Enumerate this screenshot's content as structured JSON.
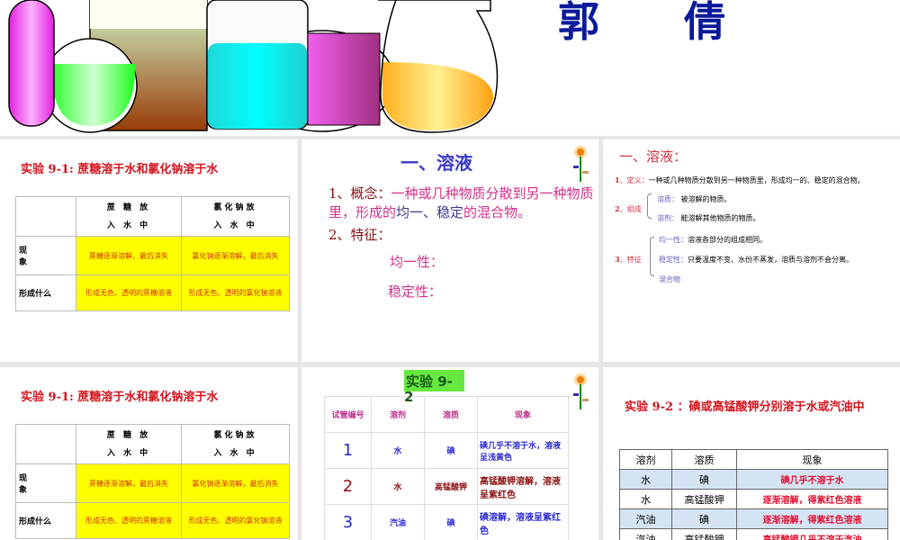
{
  "title_slide": {
    "name_1": "郭",
    "name_2": "倩"
  },
  "exp91": {
    "title": "实验 9-1: 蔗糖溶于水和氯化钠溶于水",
    "col1": [
      "蔗 糖 放",
      "入 水 中"
    ],
    "col2": [
      "氯化钠放",
      "入 水  中"
    ],
    "row1_label": [
      "现",
      "象"
    ],
    "row1": [
      "蔗糖逐渐溶解，最后消失",
      "氯化钠逐渐溶解，最后消失"
    ],
    "row2_label": "形成什么",
    "row2": [
      "形成无色、透明的蔗糖溶液",
      "形成无色、透明的氯化钠溶液"
    ]
  },
  "solution": {
    "heading": "一、溶液",
    "concept_label": "1、概念：",
    "concept_a": "一种或几种物质分散到另一种物质里，形成的",
    "concept_b": "均一、稳定",
    "concept_c": "的混合物。",
    "feature_label": "2、特征：",
    "f1": "均一性：",
    "f2": "稳定性："
  },
  "notes": {
    "heading": "一、溶液：",
    "def_num": "1",
    "def_label": "、定义：",
    "def": "一种或几种物质分散到另一种物质里，形成均一的、稳定的混合物。",
    "comp_num": "2",
    "comp_label": "、组成",
    "solute": "溶质：",
    "solute_def": "被溶解的物质。",
    "solvent": "溶剂：",
    "solvent_def": "能溶解其他物质的物质。",
    "feat_num": "3",
    "feat_label": "、特征",
    "homog": "均一性：",
    "homog_def": "溶液各部分的组成相同。",
    "stable": "稳定性：",
    "stable_def": "只要温度不变、水份不蒸发，溶质与溶剂不会分离。",
    "mixture": "混合物"
  },
  "exp92a": {
    "badge": "实验 9-",
    "badge2": "2",
    "headers": [
      "试管编号",
      "溶剂",
      "溶质",
      "现象"
    ],
    "rows": [
      [
        "1",
        "水",
        "碘",
        "碘几乎不溶于水，溶液呈浅黄色"
      ],
      [
        "2",
        "水",
        "高锰酸钾",
        "高锰酸钾溶解，溶液呈紫红色"
      ],
      [
        "3",
        "汽油",
        "碘",
        "碘溶解，溶液呈紫红色"
      ]
    ]
  },
  "exp92b": {
    "title": "实验 9-2 ：碘或高锰酸钾分别溶于水或汽油中",
    "headers": [
      "溶剂",
      "溶质",
      "现象"
    ],
    "rows": [
      [
        "水",
        "碘",
        "碘几乎不溶于水"
      ],
      [
        "水",
        "高锰酸钾",
        "逐渐溶解，得紫红色溶液"
      ],
      [
        "汽油",
        "碘",
        "逐渐溶解，得紫红色溶液"
      ],
      [
        "汽油",
        "高锰酸钾",
        "高锰酸钾几乎不溶于汽油"
      ]
    ]
  }
}
